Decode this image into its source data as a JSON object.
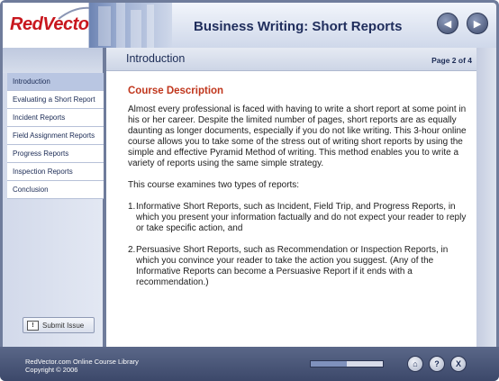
{
  "header": {
    "logo": "RedVector",
    "title": "Business Writing: Short Reports",
    "back_icon": "◀",
    "forward_icon": "▶"
  },
  "sidebar": {
    "items": [
      {
        "label": "Introduction",
        "active": true
      },
      {
        "label": "Evaluating a Short Report",
        "active": false
      },
      {
        "label": "Incident Reports",
        "active": false
      },
      {
        "label": "Field Assignment Reports",
        "active": false
      },
      {
        "label": "Progress Reports",
        "active": false
      },
      {
        "label": "Inspection Reports",
        "active": false
      },
      {
        "label": "Conclusion",
        "active": false
      }
    ],
    "submit_label": "Submit Issue"
  },
  "content": {
    "section_title": "Introduction",
    "page_indicator": "Page 2 of 4",
    "course_title": "Course Description",
    "paragraph1": "Almost every professional is faced with having to write a short report at some point in his or her career.   Despite the limited number of pages, short reports are as equally daunting as longer documents, especially if you do not like writing.   This 3-hour online course allows you to take some of the stress out of writing short reports by using the simple and effective Pyramid Method of writing.   This method enables you to write a variety of reports using the same simple strategy.",
    "paragraph2": "This course examines two types of reports:",
    "list": [
      {
        "num": "1.",
        "text": "Informative Short Reports, such as Incident, Field Trip, and Progress Reports, in which you present your information factually and do not expect your reader to reply or take specific action, and"
      },
      {
        "num": "2.",
        "text": "Persuasive Short Reports, such as Recommendation or Inspection Reports, in which you convince your reader to take the action you suggest. (Any of the Informative Reports can become a Persuasive Report if it ends with a recommendation.)"
      }
    ]
  },
  "footer": {
    "line1": "RedVector.com Online Course Library",
    "line2": "Copyright © 2006",
    "progress": 0.5,
    "home_icon": "⌂",
    "help_icon": "?",
    "close_icon": "X"
  }
}
